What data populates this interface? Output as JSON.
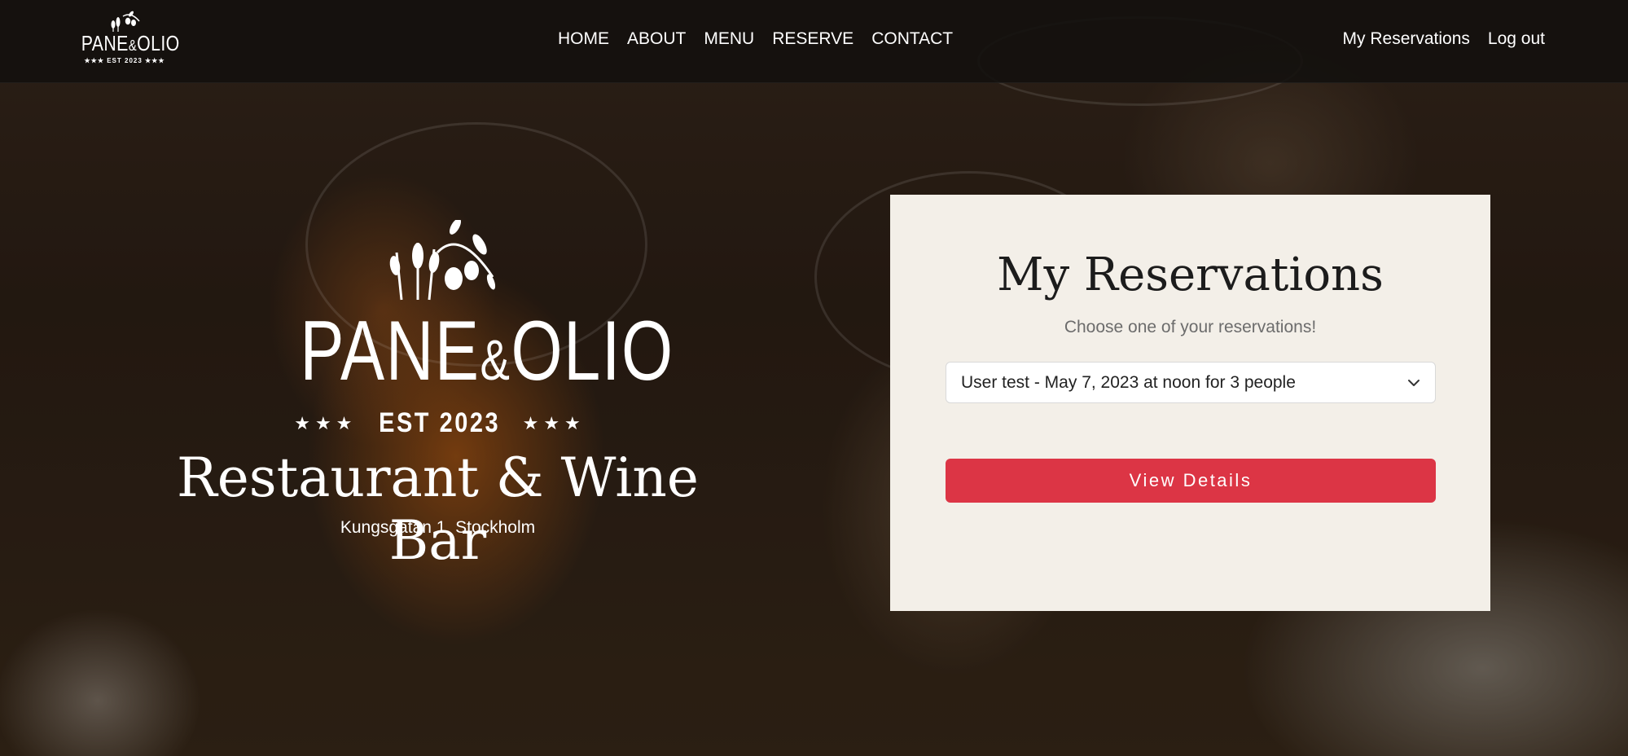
{
  "brand": {
    "name_part1": "PANE",
    "amp": "&",
    "name_part2": "OLIO",
    "est": "★★★ EST 2023 ★★★"
  },
  "nav": {
    "links": [
      "HOME",
      "ABOUT",
      "MENU",
      "RESERVE",
      "CONTACT"
    ],
    "right": [
      "My Reservations",
      "Log out"
    ]
  },
  "hero": {
    "logo_name_part1": "PANE",
    "logo_amp": "&",
    "logo_name_part2": "OLIO",
    "stars_left": "★★★",
    "est": "EST 2023",
    "stars_right": "★★★",
    "title": "Restaurant & Wine Bar",
    "address": "Kungsgatan 1, Stockholm"
  },
  "card": {
    "title": "My Reservations",
    "subtitle": "Choose one of your reservations!",
    "selected_reservation": "User test - May 7, 2023 at noon for 3 people",
    "button_label": "View Details"
  },
  "colors": {
    "accent": "#dc3545",
    "card_bg": "#f3efe8",
    "nav_bg": "#12100e"
  },
  "icons": {
    "logo": "wheat-olive-branch-icon",
    "select": "chevron-down-icon"
  }
}
